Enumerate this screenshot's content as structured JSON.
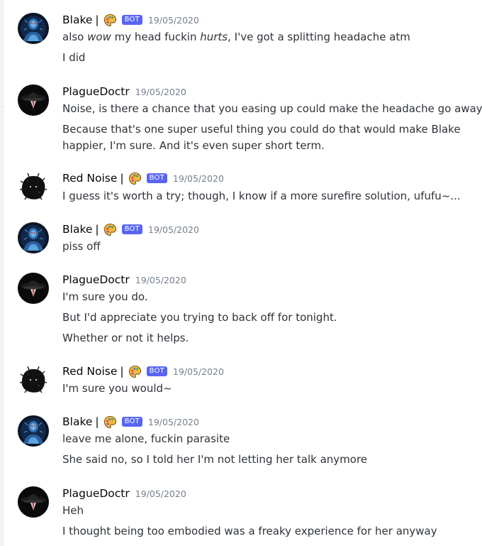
{
  "colors": {
    "background": "#ffffff",
    "username": "#060607",
    "text": "#2e3338",
    "timestamp": "#747f8d",
    "bot_tag": "#5865f2"
  },
  "messages": [
    {
      "author": "Blake",
      "sep": "|",
      "emoji": "palette-emoji",
      "bot": "BOT",
      "time": "19/05/2020",
      "avatar": "blake-avatar",
      "lines": [
        {
          "pre": "also ",
          "em1": "wow",
          "mid": " my head fuckin ",
          "em2": "hurts",
          "post": ", I've got a splitting headache atm"
        },
        {
          "text": "I did"
        }
      ]
    },
    {
      "author": "PlagueDoctr",
      "time": "19/05/2020",
      "avatar": "plaguedoctr-avatar",
      "lines": [
        {
          "text": "Noise, is there a chance that you easing up could make the headache go away?"
        },
        {
          "text": "Because that's one super useful thing you could do that would make Blake"
        },
        {
          "text": "happier, I'm sure. And it's even super short term."
        }
      ]
    },
    {
      "author": "Red Noise",
      "sep": "|",
      "emoji": "palette-emoji",
      "bot": "BOT",
      "time": "19/05/2020",
      "avatar": "red-noise-avatar",
      "lines": [
        {
          "text": "I guess it's worth a try; though, I know if a more surefire solution, ufufu~..."
        }
      ]
    },
    {
      "author": "Blake",
      "sep": "|",
      "emoji": "palette-emoji",
      "bot": "BOT",
      "time": "19/05/2020",
      "avatar": "blake-avatar",
      "lines": [
        {
          "text": "piss off"
        }
      ]
    },
    {
      "author": "PlagueDoctr",
      "time": "19/05/2020",
      "avatar": "plaguedoctr-avatar",
      "lines": [
        {
          "text": "I'm sure you do."
        },
        {
          "text": "But I'd appreciate you trying to back off for tonight."
        },
        {
          "text": "Whether or not it helps."
        }
      ]
    },
    {
      "author": "Red Noise",
      "sep": "|",
      "emoji": "palette-emoji",
      "bot": "BOT",
      "time": "19/05/2020",
      "avatar": "red-noise-avatar",
      "lines": [
        {
          "text": "I'm sure you would~"
        }
      ]
    },
    {
      "author": "Blake",
      "sep": "|",
      "emoji": "palette-emoji",
      "bot": "BOT",
      "time": "19/05/2020",
      "avatar": "blake-avatar",
      "lines": [
        {
          "text": "leave me alone, fuckin parasite"
        },
        {
          "text": "She said no, so I told her I'm not letting her talk anymore"
        }
      ]
    },
    {
      "author": "PlagueDoctr",
      "time": "19/05/2020",
      "avatar": "plaguedoctr-avatar",
      "lines": [
        {
          "text": "Heh"
        },
        {
          "text": "I thought being too embodied was a freaky experience for her anyway"
        }
      ]
    }
  ]
}
